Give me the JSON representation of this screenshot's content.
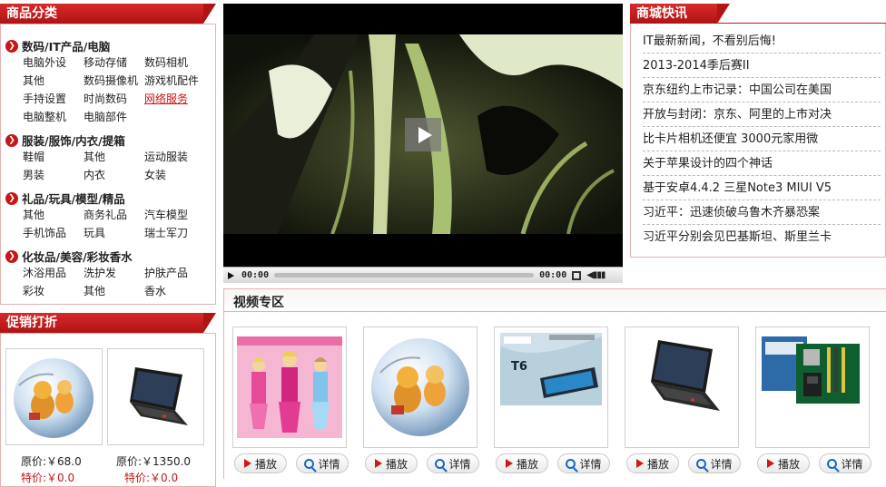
{
  "categories": {
    "title": "商品分类",
    "groups": [
      {
        "title": "数码/IT产品/电脑",
        "links": [
          "电脑外设",
          "移动存储",
          "数码相机",
          "其他",
          "数码摄像机",
          "游戏机配件",
          "手持设置",
          "时尚数码",
          "网络服务",
          "电脑整机",
          "电脑部件"
        ],
        "highlight": 8
      },
      {
        "title": "服装/服饰/内衣/提箱",
        "links": [
          "鞋帽",
          "其他",
          "运动服装",
          "男装",
          "内衣",
          "女装"
        ]
      },
      {
        "title": "礼品/玩具/模型/精品",
        "links": [
          "其他",
          "商务礼品",
          "汽车模型",
          "手机饰品",
          "玩具",
          "瑞士军刀"
        ]
      },
      {
        "title": "化妆品/美容/彩妆香水",
        "links": [
          "沐浴用品",
          "洗护发",
          "护肤产品",
          "彩妆",
          "其他",
          "香水"
        ]
      }
    ]
  },
  "promo": {
    "title": "促销打折",
    "items": [
      {
        "image_icon": "globe-puzzle-icon",
        "orig_label": "原价:￥68.0",
        "sale_label": "特价:￥0.0"
      },
      {
        "image_icon": "laptop-icon",
        "orig_label": "原价:￥1350.0",
        "sale_label": "特价:￥0.0"
      }
    ]
  },
  "player": {
    "time_current": "00:00",
    "time_total": "00:00",
    "play_icon": "play-icon",
    "fullscreen_icon": "fullscreen-icon",
    "volume_icon": "volume-icon"
  },
  "news": {
    "title": "商城快讯",
    "items": [
      "IT最新新闻，不看别后悔!",
      "2013-2014季后赛II",
      "京东纽约上市记录：中国公司在美国",
      "开放与封闭：京东、阿里的上市对决",
      "比卡片相机还便宜 3000元家用微",
      "关于苹果设计的四个神话",
      "基于安卓4.4.2 三星Note3 MIUI V5",
      "习近平：迅速侦破乌鲁木齐暴恐案",
      "习近平分别会见巴基斯坦、斯里兰卡"
    ]
  },
  "videos": {
    "title": "视频专区",
    "play_label": "播放",
    "detail_label": "详情",
    "cards": [
      {
        "image_icon": "dolls-icon"
      },
      {
        "image_icon": "globe-puzzle-icon"
      },
      {
        "image_icon": "phone-ad-icon",
        "ad_text": "T6"
      },
      {
        "image_icon": "laptop-icon"
      },
      {
        "image_icon": "motherboard-icon"
      }
    ]
  },
  "colors": {
    "accent": "#c81616",
    "border": "#e3b3b3"
  }
}
